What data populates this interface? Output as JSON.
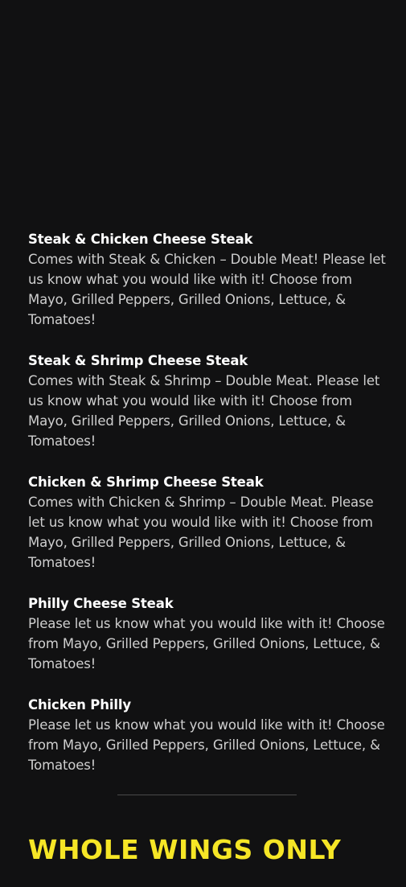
{
  "menu": {
    "items": [
      {
        "title": "Steak & Chicken Cheese Steak",
        "description": "Comes with Steak & Chicken – Double Meat! Please let us know what you would like with it! Choose from Mayo, Grilled Peppers, Grilled Onions, Lettuce, & Tomatoes!"
      },
      {
        "title": "Steak & Shrimp Cheese Steak",
        "description": "Comes with Steak & Shrimp – Double Meat. Please let us know what you would like with it! Choose from Mayo, Grilled Peppers, Grilled Onions, Lettuce, & Tomatoes!"
      },
      {
        "title": "Chicken & Shrimp Cheese Steak",
        "description": "Comes with Chicken & Shrimp – Double Meat. Please let us know what you would like with it! Choose from Mayo, Grilled Peppers, Grilled Onions, Lettuce, & Tomatoes!"
      },
      {
        "title": "Philly Cheese Steak",
        "description": "Please let us know what you would like with it! Choose from Mayo, Grilled Peppers, Grilled Onions, Lettuce, & Tomatoes!"
      },
      {
        "title": "Chicken Philly",
        "description": "Please let us know what you would like with it! Choose from Mayo, Grilled Peppers, Grilled Onions, Lettuce, & Tomatoes!"
      }
    ]
  },
  "section": {
    "heading": "WHOLE WINGS ONLY"
  },
  "colors": {
    "background": "#111112",
    "title": "#ffffff",
    "description": "#cfcfcf",
    "accent": "#f6e626",
    "divider": "#4a4a4a"
  }
}
